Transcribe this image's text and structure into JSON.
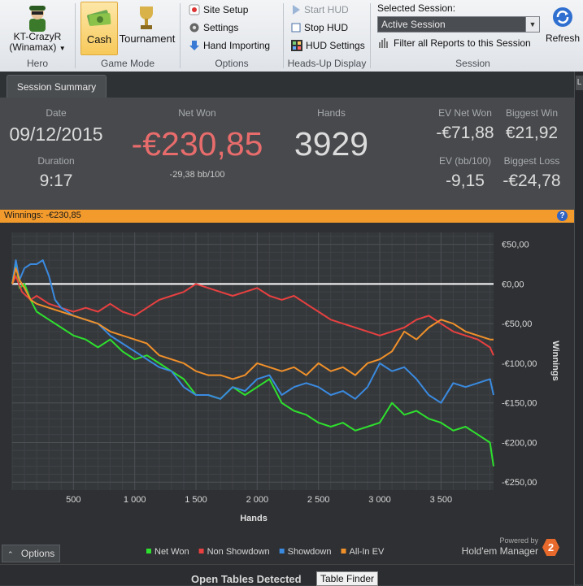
{
  "ribbon": {
    "hero": {
      "name": "KT-CrazyR",
      "site": "(Winamax)",
      "group_label": "Hero"
    },
    "game_mode": {
      "cash": "Cash",
      "tournament": "Tournament",
      "group_label": "Game Mode"
    },
    "options": {
      "site_setup": "Site Setup",
      "settings": "Settings",
      "hand_importing": "Hand Importing",
      "group_label": "Options"
    },
    "hud": {
      "start": "Start HUD",
      "stop": "Stop HUD",
      "settings": "HUD Settings",
      "group_label": "Heads-Up Display"
    },
    "session": {
      "selected_label": "Selected Session:",
      "selected_value": "Active Session",
      "filter": "Filter all Reports to this Session",
      "refresh": "Refresh",
      "group_label": "Session"
    }
  },
  "tabs": {
    "summary": "Session Summary",
    "right_tab": "L"
  },
  "summary": {
    "date_label": "Date",
    "date": "09/12/2015",
    "duration_label": "Duration",
    "duration": "9:17",
    "net_won_label": "Net Won",
    "net_won": "-€230,85",
    "net_won_bb": "-29,38 bb/100",
    "hands_label": "Hands",
    "hands": "3929",
    "ev_net_won_label": "EV Net Won",
    "ev_net_won": "-€71,88",
    "ev_bb_label": "EV (bb/100)",
    "ev_bb": "-9,15",
    "biggest_win_label": "Biggest Win",
    "biggest_win": "€21,92",
    "biggest_loss_label": "Biggest Loss",
    "biggest_loss": "-€24,78"
  },
  "banner": {
    "text": "Winnings: -€230,85"
  },
  "chart_data": {
    "type": "line",
    "xlabel": "Hands",
    "ylabel": "Winnings",
    "xlim": [
      0,
      3929
    ],
    "ylim": [
      -260,
      65
    ],
    "x_ticks": [
      500,
      1000,
      1500,
      2000,
      2500,
      3000,
      3500
    ],
    "x_tick_labels": [
      "500",
      "1 000",
      "1 500",
      "2 000",
      "2 500",
      "3 000",
      "3 500"
    ],
    "y_ticks": [
      50,
      0,
      -50,
      -100,
      -150,
      -200,
      -250
    ],
    "y_tick_labels": [
      "€50,00",
      "€0,00",
      "-€50,00",
      "-€100,00",
      "-€150,00",
      "-€200,00",
      "-€250,00"
    ],
    "grid": true,
    "legend_position": "bottom",
    "zero_line": true,
    "series": [
      {
        "name": "Net Won",
        "color": "#2ee02e",
        "x": [
          0,
          30,
          60,
          100,
          150,
          200,
          300,
          400,
          500,
          600,
          700,
          800,
          900,
          1000,
          1100,
          1200,
          1300,
          1400,
          1500,
          1600,
          1700,
          1800,
          1900,
          2000,
          2100,
          2200,
          2300,
          2400,
          2500,
          2600,
          2700,
          2800,
          2900,
          3000,
          3100,
          3200,
          3300,
          3400,
          3500,
          3600,
          3700,
          3800,
          3900,
          3929
        ],
        "y": [
          0,
          28,
          -5,
          0,
          -20,
          -35,
          -45,
          -55,
          -65,
          -70,
          -80,
          -70,
          -85,
          -95,
          -90,
          -100,
          -110,
          -120,
          -140,
          -140,
          -145,
          -130,
          -140,
          -130,
          -120,
          -150,
          -160,
          -165,
          -175,
          -180,
          -175,
          -185,
          -180,
          -175,
          -150,
          -165,
          -160,
          -170,
          -175,
          -185,
          -180,
          -190,
          -200,
          -230
        ]
      },
      {
        "name": "Non Showdown",
        "color": "#e84040",
        "x": [
          0,
          30,
          80,
          150,
          200,
          300,
          400,
          500,
          600,
          700,
          800,
          900,
          1000,
          1100,
          1200,
          1300,
          1400,
          1500,
          1600,
          1700,
          1800,
          1900,
          2000,
          2100,
          2200,
          2300,
          2400,
          2500,
          2600,
          2700,
          2800,
          2900,
          3000,
          3100,
          3200,
          3300,
          3400,
          3500,
          3600,
          3700,
          3800,
          3900,
          3929
        ],
        "y": [
          0,
          10,
          -10,
          -20,
          -15,
          -25,
          -30,
          -35,
          -30,
          -35,
          -25,
          -35,
          -40,
          -30,
          -20,
          -15,
          -10,
          0,
          -5,
          -10,
          -15,
          -10,
          -5,
          -15,
          -20,
          -15,
          -25,
          -35,
          -45,
          -50,
          -55,
          -60,
          -65,
          -60,
          -55,
          -45,
          -40,
          -50,
          -60,
          -65,
          -70,
          -80,
          -90
        ]
      },
      {
        "name": "Showdown",
        "color": "#3a8ae0",
        "x": [
          0,
          30,
          60,
          100,
          150,
          200,
          250,
          300,
          350,
          400,
          450,
          500,
          600,
          700,
          800,
          900,
          1000,
          1100,
          1200,
          1300,
          1400,
          1500,
          1600,
          1700,
          1800,
          1900,
          2000,
          2100,
          2200,
          2300,
          2400,
          2500,
          2600,
          2700,
          2800,
          2900,
          3000,
          3100,
          3200,
          3300,
          3400,
          3500,
          3600,
          3700,
          3800,
          3900,
          3929
        ],
        "y": [
          0,
          30,
          5,
          20,
          25,
          25,
          30,
          10,
          -20,
          -30,
          -35,
          -40,
          -45,
          -50,
          -65,
          -75,
          -85,
          -95,
          -105,
          -110,
          -130,
          -140,
          -140,
          -145,
          -130,
          -135,
          -120,
          -115,
          -140,
          -130,
          -125,
          -130,
          -140,
          -135,
          -145,
          -130,
          -100,
          -110,
          -105,
          -120,
          -140,
          -150,
          -125,
          -130,
          -125,
          -120,
          -140
        ]
      },
      {
        "name": "All-In EV",
        "color": "#f0902a",
        "x": [
          0,
          30,
          60,
          100,
          150,
          200,
          300,
          400,
          500,
          600,
          700,
          800,
          900,
          1000,
          1100,
          1200,
          1300,
          1400,
          1500,
          1600,
          1700,
          1800,
          1900,
          2000,
          2100,
          2200,
          2300,
          2400,
          2500,
          2600,
          2700,
          2800,
          2900,
          3000,
          3100,
          3200,
          3300,
          3400,
          3500,
          3600,
          3700,
          3800,
          3900,
          3929
        ],
        "y": [
          0,
          20,
          5,
          -5,
          -20,
          -25,
          -30,
          -35,
          -40,
          -45,
          -50,
          -60,
          -65,
          -70,
          -75,
          -90,
          -95,
          -100,
          -110,
          -115,
          -115,
          -120,
          -115,
          -100,
          -105,
          -110,
          -105,
          -115,
          -100,
          -110,
          -105,
          -115,
          -100,
          -95,
          -85,
          -60,
          -70,
          -55,
          -45,
          -50,
          -60,
          -65,
          -70,
          -70
        ]
      }
    ]
  },
  "footer": {
    "options": "Options",
    "powered_by": "Powered by",
    "brand": "Hold'em Manager",
    "brand_version": "2",
    "open_tables": "Open Tables Detected",
    "table_finder": "Table Finder"
  },
  "colors": {
    "accent": "#f29a2b",
    "net_won_red": "#e86c6c"
  }
}
